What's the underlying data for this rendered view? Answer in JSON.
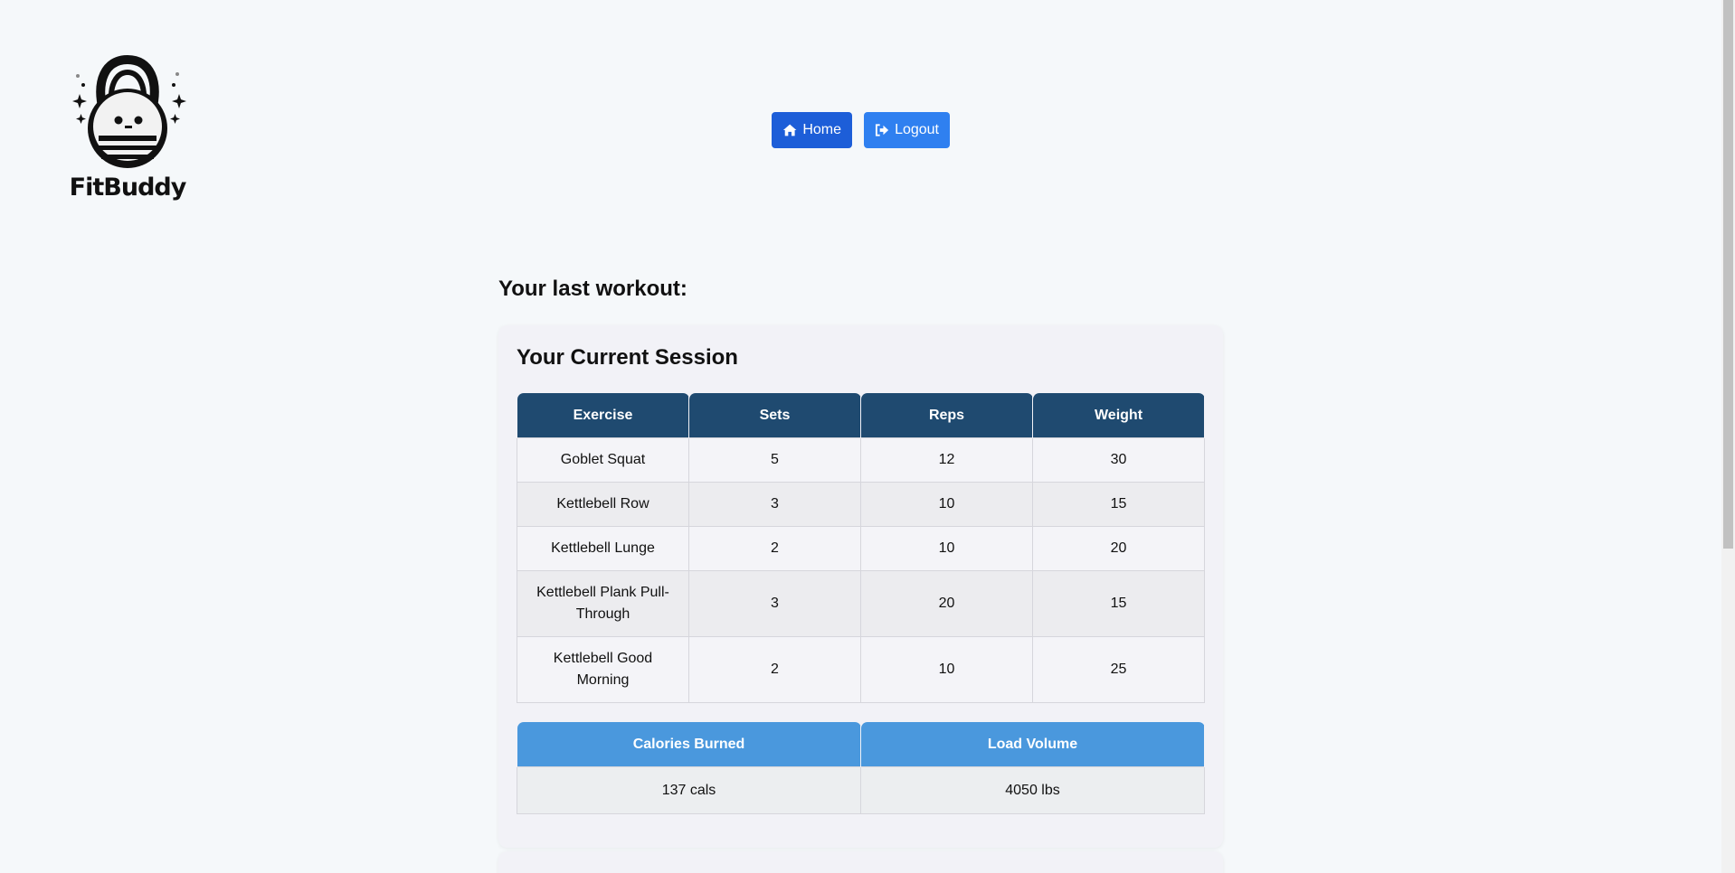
{
  "logo": {
    "text": "FitBuddy",
    "icon": "kettlebell-mascot-icon"
  },
  "nav": {
    "home": {
      "label": "Home",
      "icon": "home-icon"
    },
    "logout": {
      "label": "Logout",
      "icon": "logout-icon"
    }
  },
  "heading": "Your last workout:",
  "session": {
    "title": "Your Current Session",
    "columns": [
      "Exercise",
      "Sets",
      "Reps",
      "Weight"
    ],
    "rows": [
      {
        "exercise": "Goblet Squat",
        "sets": "5",
        "reps": "12",
        "weight": "30"
      },
      {
        "exercise": "Kettlebell Row",
        "sets": "3",
        "reps": "10",
        "weight": "15"
      },
      {
        "exercise": "Kettlebell Lunge",
        "sets": "2",
        "reps": "10",
        "weight": "20"
      },
      {
        "exercise": "Kettlebell Plank Pull-Through",
        "sets": "3",
        "reps": "20",
        "weight": "15"
      },
      {
        "exercise": "Kettlebell Good Morning",
        "sets": "2",
        "reps": "10",
        "weight": "25"
      }
    ],
    "summary": {
      "columns": [
        "Calories Burned",
        "Load Volume"
      ],
      "values": [
        "137 cals",
        "4050 lbs"
      ]
    }
  },
  "colors": {
    "home_button": "#1d5ed8",
    "logout_button": "#2f80f0",
    "table_header": "#1f4a70",
    "summary_header": "#4a98dd",
    "background": "#f5f8fa"
  }
}
